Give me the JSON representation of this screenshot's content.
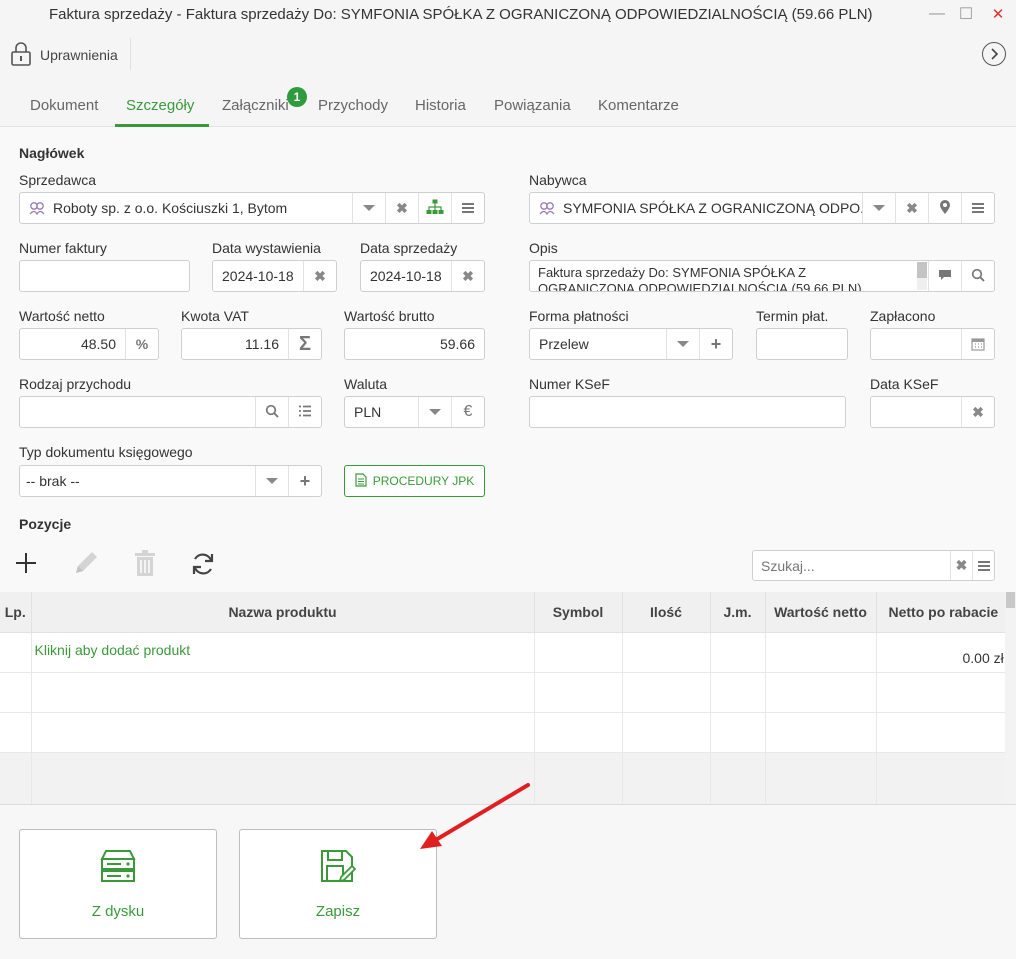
{
  "window": {
    "title": "Faktura sprzedaży - Faktura sprzedaży Do: SYMFONIA SPÓŁKA Z OGRANICZONĄ ODPOWIEDZIALNOŚCIĄ (59.66 PLN)",
    "minimize": "—",
    "maximize": "☐",
    "close": "✕"
  },
  "toolbar": {
    "permissions_label": "Uprawnienia",
    "permissions_icon": "lock-icon",
    "next_icon": "chevron-right-circle-icon"
  },
  "tabs": [
    {
      "label": "Dokument"
    },
    {
      "label": "Szczegóły"
    },
    {
      "label": "Załączniki"
    },
    {
      "label": "Przychody"
    },
    {
      "label": "Historia"
    },
    {
      "label": "Powiązania"
    },
    {
      "label": "Komentarze"
    }
  ],
  "active_tab": "Szczegóły",
  "attachments_badge": "1",
  "header": {
    "section_title": "Nagłówek",
    "seller_label": "Sprzedawca",
    "seller_value": "Roboty sp. z o.o. Kościuszki 1, Bytom",
    "buyer_label": "Nabywca",
    "buyer_value": "SYMFONIA SPÓŁKA Z OGRANICZONĄ ODPO...",
    "invoice_number_label": "Numer faktury",
    "invoice_number_value": "",
    "issue_date_label": "Data wystawienia",
    "issue_date_value": "2024-10-18",
    "sale_date_label": "Data sprzedaży",
    "sale_date_value": "2024-10-18",
    "description_label": "Opis",
    "description_line1": "Faktura sprzedaży Do: SYMFONIA SPÓŁKA Z",
    "description_line2": "OGRANICZONĄ ODPOWIEDZIALNOŚCIĄ (59.66 PLN)",
    "net_label": "Wartość netto",
    "net_value": "48.50",
    "net_suffix": "%",
    "vat_label": "Kwota VAT",
    "vat_value": "11.16",
    "vat_suffix": "Σ",
    "gross_label": "Wartość brutto",
    "gross_value": "59.66",
    "payment_form_label": "Forma płatności",
    "payment_form_value": "Przelew",
    "payment_term_label": "Termin płat.",
    "payment_term_value": "",
    "paid_label": "Zapłacono",
    "paid_value": "",
    "revenue_type_label": "Rodzaj przychodu",
    "revenue_type_value": "",
    "currency_label": "Waluta",
    "currency_value": "PLN",
    "currency_suffix": "€",
    "ksef_number_label": "Numer KSeF",
    "ksef_number_value": "",
    "ksef_date_label": "Data KSeF",
    "ksef_date_value": "",
    "doc_type_label": "Typ dokumentu księgowego",
    "doc_type_value": "-- brak --",
    "jpk_button": "PROCEDURY JPK"
  },
  "positions": {
    "section_title": "Pozycje",
    "search_placeholder": "Szukaj...",
    "columns": [
      "Lp.",
      "Nazwa produktu",
      "Symbol",
      "Ilość",
      "J.m.",
      "Wartość netto",
      "Netto po rabacie"
    ],
    "add_product_text": "Kliknij aby dodać produkt",
    "net_after_discount_total": "0.00 zł"
  },
  "footer": {
    "from_disk_label": "Z dysku",
    "save_label": "Zapisz"
  },
  "colors": {
    "accent": "#3a9a3a",
    "badge": "#2e9b3c",
    "arrow": "#e02020"
  }
}
